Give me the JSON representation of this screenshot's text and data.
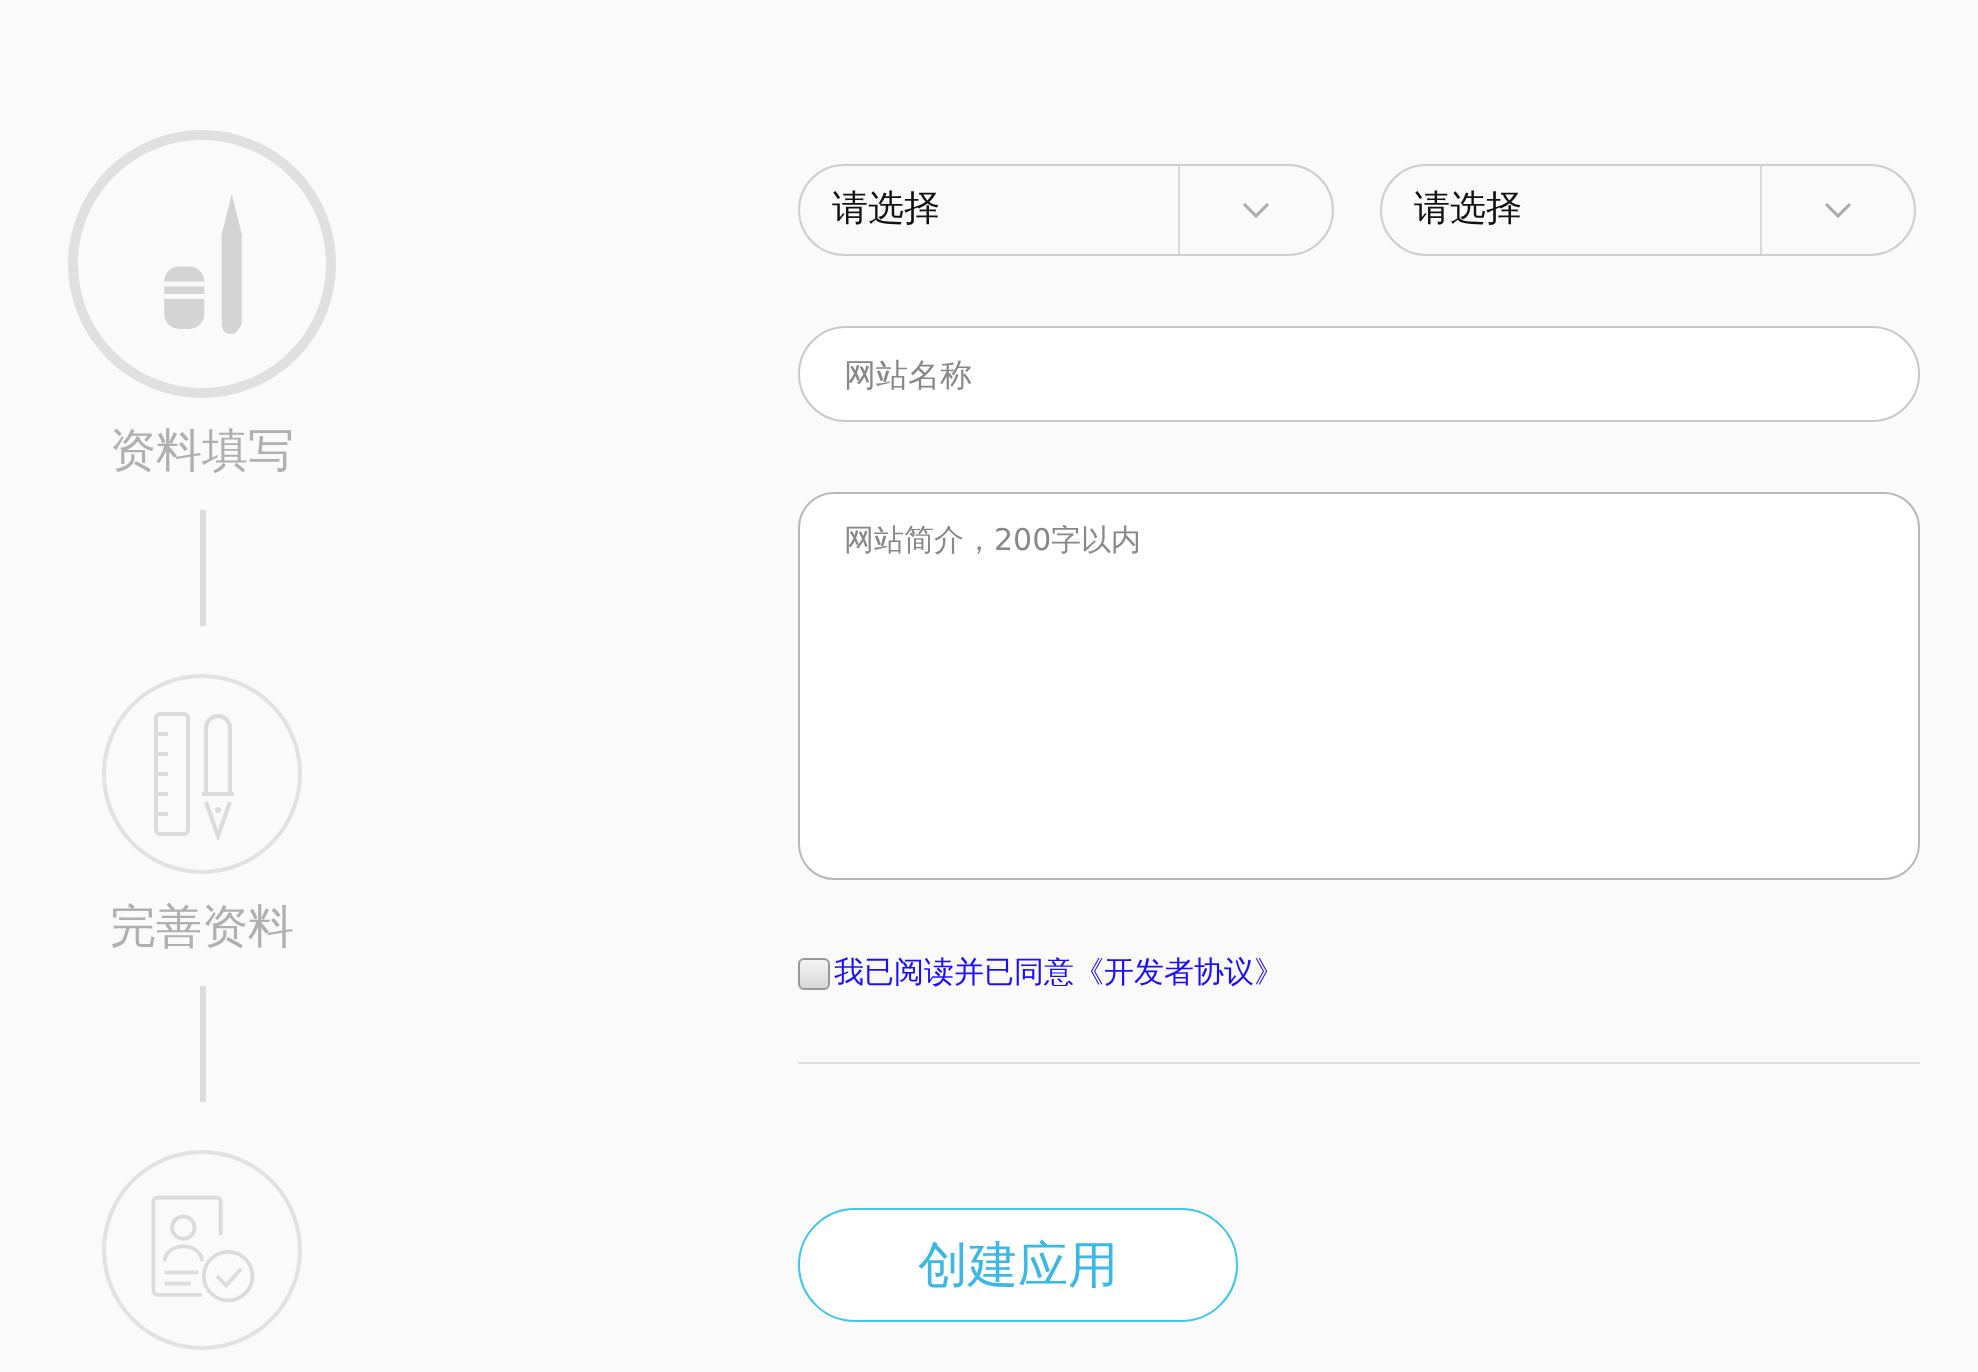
{
  "steps": [
    {
      "label": "资料填写",
      "selected": true
    },
    {
      "label": "完善资料",
      "selected": false
    },
    {
      "selected": false
    }
  ],
  "selects": [
    {
      "value": "请选择"
    },
    {
      "value": "请选择"
    }
  ],
  "name_field": {
    "placeholder": "网站名称"
  },
  "description_field": {
    "placeholder": "网站简介，200字以内"
  },
  "agreement": {
    "checked": false,
    "text": "我已阅读并已同意",
    "link": "《开发者协议》"
  },
  "submit_button": "创建应用"
}
